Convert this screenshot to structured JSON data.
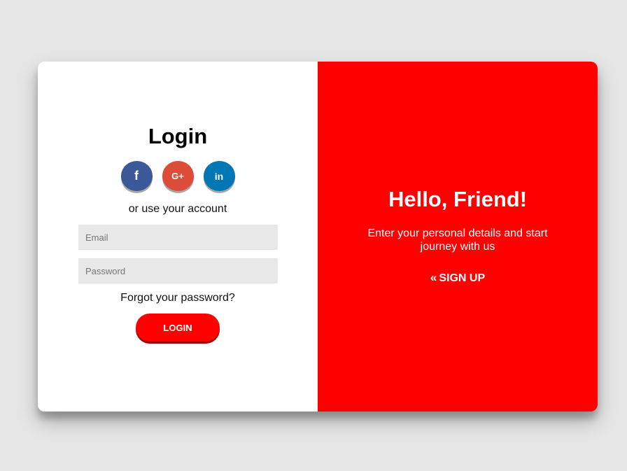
{
  "login_panel": {
    "title": "Login",
    "socials": [
      {
        "icon": "facebook-icon",
        "glyph": "f",
        "color": "#3b5998"
      },
      {
        "icon": "google-plus-icon",
        "glyph": "G+",
        "color": "#dd4b39"
      },
      {
        "icon": "linkedin-icon",
        "glyph": "in",
        "color": "#0077b5"
      }
    ],
    "alt_text": "or use your account",
    "email_placeholder": "Email",
    "password_placeholder": "Password",
    "forgot_label": "Forgot your password?",
    "login_button": "LOGIN"
  },
  "signup_panel": {
    "title": "Hello, Friend!",
    "text": "Enter your personal details and start journey with us",
    "signup_icon": "double-chevron-left-icon",
    "signup_label": "SIGN UP"
  },
  "colors": {
    "background": "#e6e6e6",
    "accent": "#ff0000",
    "input_bg": "#e8e8e8"
  }
}
